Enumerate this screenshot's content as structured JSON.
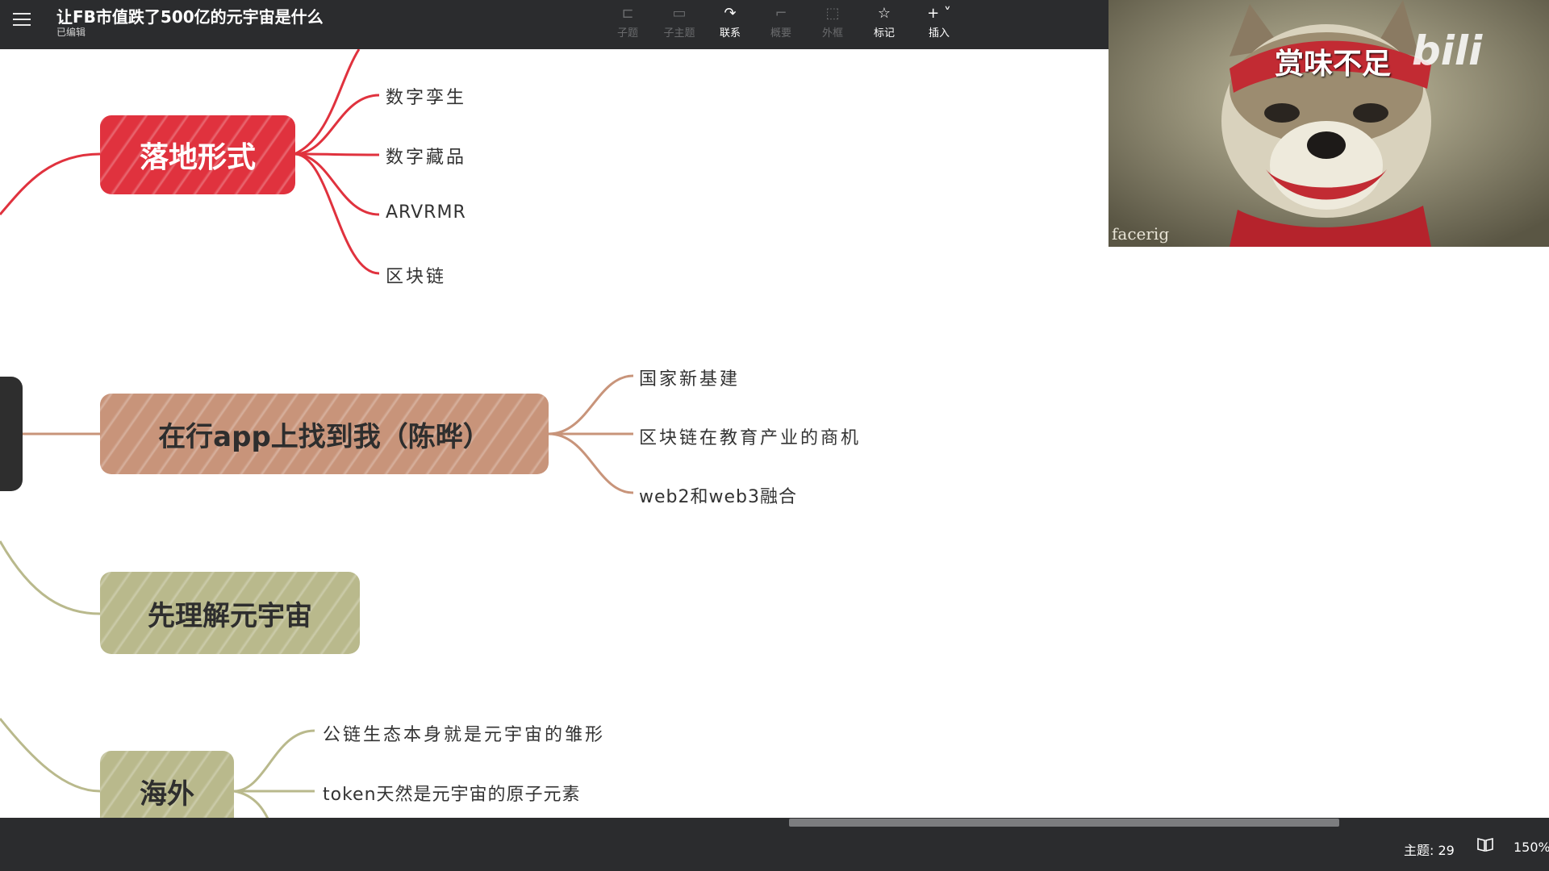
{
  "header": {
    "title": "让FB市值跌了500亿的元宇宙是什么",
    "status": "已编辑",
    "tools": [
      {
        "icon": "子主题-icon",
        "label": "子题",
        "enabled": false
      },
      {
        "icon": "同级主题-icon",
        "label": "子主题",
        "enabled": false
      },
      {
        "icon": "connect-icon",
        "label": "联系",
        "enabled": true
      },
      {
        "icon": "summary-icon",
        "label": "概要",
        "enabled": false
      },
      {
        "icon": "boundary-icon",
        "label": "外框",
        "enabled": false
      },
      {
        "icon": "star-icon",
        "label": "标记",
        "enabled": true
      },
      {
        "icon": "plus-icon",
        "label": "插入",
        "enabled": true
      }
    ]
  },
  "mindmap": {
    "nodes": [
      {
        "label": "落地形式",
        "color": "#e0323e",
        "children": [
          "数字孪生",
          "数字藏品",
          "ARVRMR",
          "区块链"
        ]
      },
      {
        "label": "在行app上找到我（陈晔）",
        "color": "#c8947a",
        "children": [
          "国家新基建",
          "区块链在教育产业的商机",
          "web2和web3融合"
        ]
      },
      {
        "label": "先理解元宇宙",
        "color": "#b9b98c",
        "children": []
      },
      {
        "label": "海外",
        "color": "#b9b98c",
        "children": [
          "公链生态本身就是元宇宙的雏形",
          "token天然是元宇宙的原子元素"
        ]
      }
    ]
  },
  "video": {
    "caption": "赏味不足",
    "watermark": "facerig",
    "logo": "bili"
  },
  "statusbar": {
    "topic_count": "主题: 29",
    "zoom": "150%"
  },
  "colors": {
    "dark_bar": "#2b2c2e",
    "red": "#e0323e",
    "tan": "#c8947a",
    "olive": "#b9b98c"
  }
}
